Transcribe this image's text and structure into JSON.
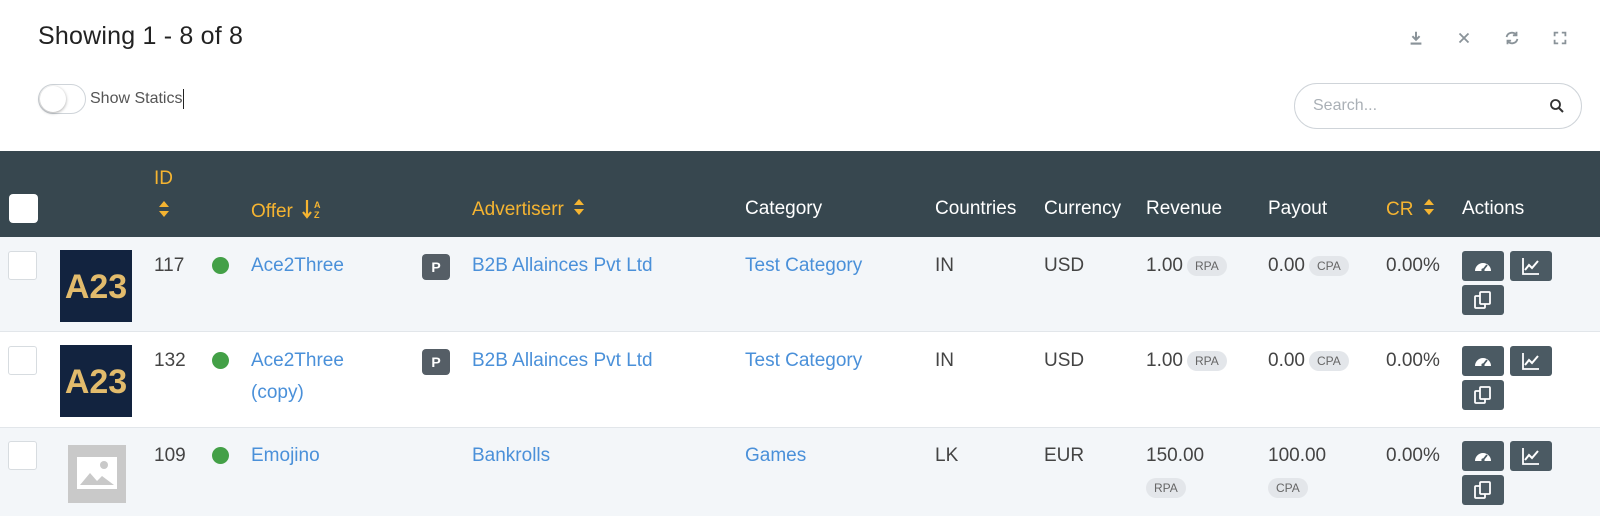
{
  "header": {
    "title": "Showing 1 - 8 of 8",
    "tools": [
      "download-icon",
      "close-icon",
      "refresh-icon",
      "fullscreen-icon"
    ]
  },
  "toggle": {
    "label": "Show Statics",
    "on": false
  },
  "search": {
    "placeholder": "Search..."
  },
  "colors": {
    "header_bg": "#37474f",
    "sort_accent": "#f5b431",
    "link": "#4a90d9",
    "active_dot": "#43a047",
    "button_bg": "#4b5a63"
  },
  "columns": {
    "id": "ID",
    "offer": "Offer",
    "advertiser": "Advertiserr",
    "category": "Category",
    "countries": "Countries",
    "currency": "Currency",
    "revenue": "Revenue",
    "payout": "Payout",
    "cr": "CR",
    "actions": "Actions"
  },
  "rows": [
    {
      "id": "117",
      "logo": "A23",
      "status": "active",
      "offer": "Ace2Three",
      "offer_line2": "",
      "private_badge": "P",
      "advertiser": "B2B Allainces Pvt Ltd",
      "category": "Test Category",
      "countries": "IN",
      "currency": "USD",
      "revenue": "1.00",
      "revenue_type": "RPA",
      "payout": "0.00",
      "payout_type": "CPA",
      "cr": "0.00%"
    },
    {
      "id": "132",
      "logo": "A23",
      "status": "active",
      "offer": "Ace2Three",
      "offer_line2": "(copy)",
      "private_badge": "P",
      "advertiser": "B2B Allainces Pvt Ltd",
      "category": "Test Category",
      "countries": "IN",
      "currency": "USD",
      "revenue": "1.00",
      "revenue_type": "RPA",
      "payout": "0.00",
      "payout_type": "CPA",
      "cr": "0.00%"
    },
    {
      "id": "109",
      "logo": "image-placeholder-icon",
      "status": "active",
      "offer": "Emojino",
      "offer_line2": "",
      "private_badge": "",
      "advertiser": "Bankrolls",
      "category": "Games",
      "countries": "LK",
      "currency": "EUR",
      "revenue": "150.00",
      "revenue_type": "RPA",
      "payout": "100.00",
      "payout_type": "CPA",
      "cr": "0.00%"
    }
  ],
  "row_actions": [
    "dashboard-icon",
    "chart-icon",
    "copy-icon"
  ]
}
